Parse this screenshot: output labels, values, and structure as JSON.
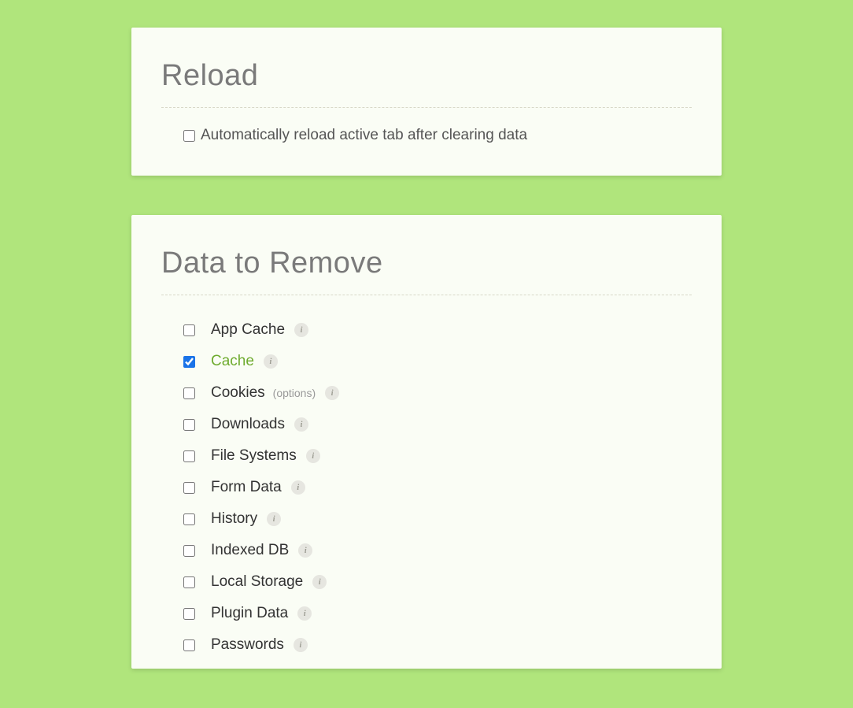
{
  "reload": {
    "title": "Reload",
    "checkbox_label": "Automatically reload active tab after clearing data",
    "checked": false
  },
  "data_to_remove": {
    "title": "Data to Remove",
    "options_text": "(options)",
    "info_glyph": "i",
    "items": [
      {
        "label": "App Cache",
        "checked": false,
        "has_options": false
      },
      {
        "label": "Cache",
        "checked": true,
        "has_options": false
      },
      {
        "label": "Cookies",
        "checked": false,
        "has_options": true
      },
      {
        "label": "Downloads",
        "checked": false,
        "has_options": false
      },
      {
        "label": "File Systems",
        "checked": false,
        "has_options": false
      },
      {
        "label": "Form Data",
        "checked": false,
        "has_options": false
      },
      {
        "label": "History",
        "checked": false,
        "has_options": false
      },
      {
        "label": "Indexed DB",
        "checked": false,
        "has_options": false
      },
      {
        "label": "Local Storage",
        "checked": false,
        "has_options": false
      },
      {
        "label": "Plugin Data",
        "checked": false,
        "has_options": false
      },
      {
        "label": "Passwords",
        "checked": false,
        "has_options": false
      }
    ]
  }
}
